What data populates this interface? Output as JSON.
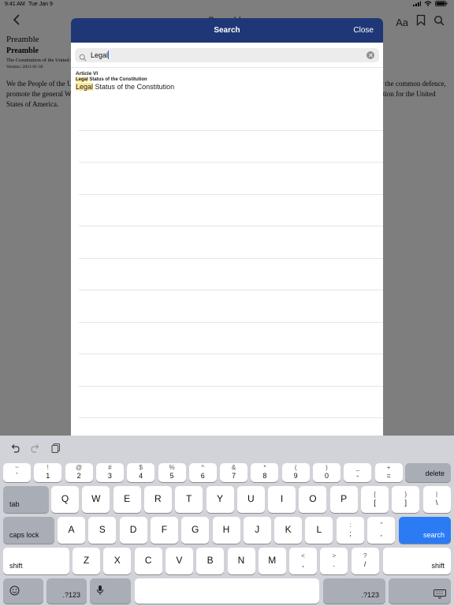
{
  "status": {
    "time": "9:41 AM",
    "date": "Tue Jan 9",
    "battery": "100%"
  },
  "nav": {
    "title": "Preamble",
    "font_label": "Aa"
  },
  "document": {
    "section": "Preamble",
    "title": "Preamble",
    "subtitle": "The Constitution of the United States",
    "version": "Version | 2021-01-30",
    "body": "We the People of the United States, in Order to form a more perfect Union, establish Justice, insure domestic Tranquility, provide for the common defence, promote the general Welfare, and secure the Blessings of Liberty to ourselves and our Posterity, do ordain and establish this Constitution for the United States of America."
  },
  "modal": {
    "title": "Search",
    "close_label": "Close",
    "search_value": "Legal",
    "results": [
      {
        "article": "Article VI",
        "path_highlight": "Legal",
        "path_rest": " Status of the Constitution",
        "title_highlight": "Legal",
        "title_rest": " Status of the Constitution"
      }
    ]
  },
  "keyboard": {
    "number_row": [
      {
        "top": "~",
        "bot": "`"
      },
      {
        "top": "!",
        "bot": "1"
      },
      {
        "top": "@",
        "bot": "2"
      },
      {
        "top": "#",
        "bot": "3"
      },
      {
        "top": "$",
        "bot": "4"
      },
      {
        "top": "%",
        "bot": "5"
      },
      {
        "top": "^",
        "bot": "6"
      },
      {
        "top": "&",
        "bot": "7"
      },
      {
        "top": "*",
        "bot": "8"
      },
      {
        "top": "(",
        "bot": "9"
      },
      {
        "top": ")",
        "bot": "0"
      },
      {
        "top": "_",
        "bot": "-"
      },
      {
        "top": "+",
        "bot": "="
      }
    ],
    "delete_label": "delete",
    "tab_label": "tab",
    "row_q": [
      "Q",
      "W",
      "E",
      "R",
      "T",
      "Y",
      "U",
      "I",
      "O",
      "P"
    ],
    "row_q_extra": [
      {
        "top": "{",
        "bot": "["
      },
      {
        "top": "}",
        "bot": "]"
      },
      {
        "top": "|",
        "bot": "\\"
      }
    ],
    "caps_label": "caps lock",
    "row_a": [
      "A",
      "S",
      "D",
      "F",
      "G",
      "H",
      "J",
      "K",
      "L"
    ],
    "row_a_extra": [
      {
        "top": ":",
        "bot": ";"
      },
      {
        "top": "\"",
        "bot": ","
      }
    ],
    "search_label": "search",
    "shift_label": "shift",
    "row_z": [
      "Z",
      "X",
      "C",
      "V",
      "B",
      "N",
      "M"
    ],
    "row_z_extra": [
      {
        "top": "<",
        "bot": ","
      },
      {
        "top": ">",
        "bot": "."
      },
      {
        "top": "?",
        "bot": "/"
      }
    ],
    "numbers_label": ".?123"
  }
}
